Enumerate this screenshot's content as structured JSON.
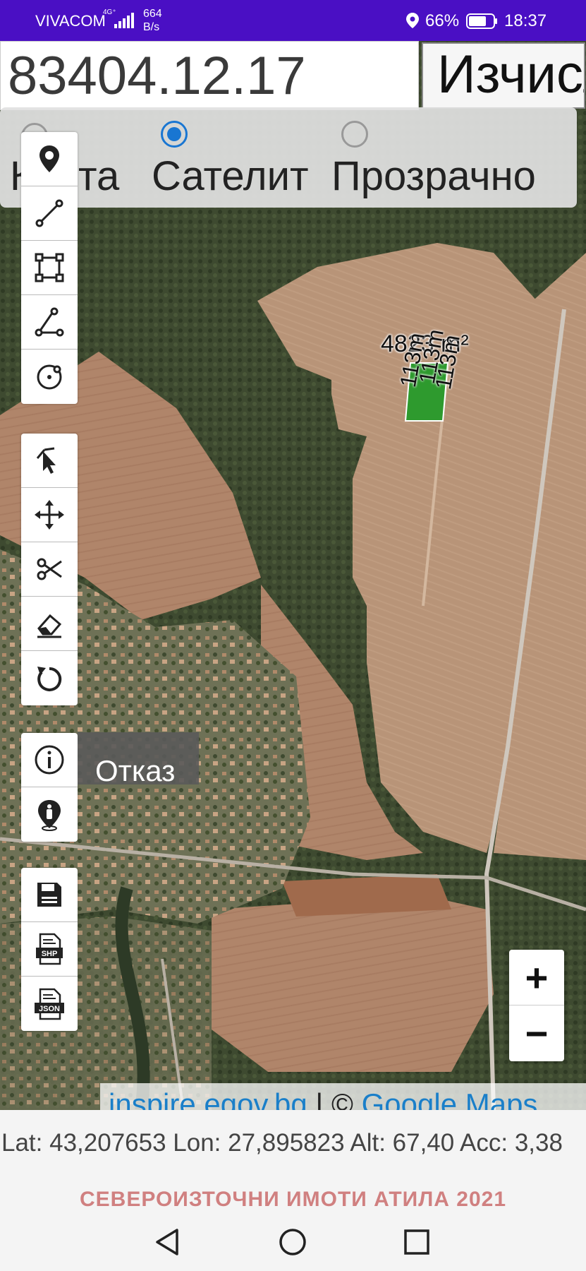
{
  "status_bar": {
    "carrier": "VIVACOM",
    "network_type": "4G⁺",
    "speed_value": "664",
    "speed_unit": "B/s",
    "battery_percent": "66%",
    "time": "18:37"
  },
  "search": {
    "value": "83404.12.17"
  },
  "calc_button": {
    "label": "Изчисли"
  },
  "map_type": {
    "options": [
      {
        "label": "Карта",
        "selected": false
      },
      {
        "label": "Сателит",
        "selected": true
      },
      {
        "label": "Прозрачно",
        "selected": false
      }
    ]
  },
  "toolbar_icons": {
    "group1": [
      "marker-icon",
      "line-icon",
      "rectangle-icon",
      "angle-icon",
      "circle-icon"
    ],
    "group2": [
      "select-icon",
      "move-icon",
      "cut-icon",
      "eraser-icon",
      "undo-icon"
    ],
    "group3": [
      "info-icon",
      "person-location-icon"
    ],
    "group4": [
      "save-icon",
      "shp-icon",
      "json-icon"
    ]
  },
  "file_icons": {
    "shp": "SHP",
    "json": "JSON"
  },
  "tooltip": {
    "text": "Отказ"
  },
  "measurement": {
    "area": "4823 m²",
    "segment_labels": [
      "113m",
      "113m",
      "113m"
    ]
  },
  "zoom": {
    "plus": "+",
    "minus": "−"
  },
  "attribution": {
    "link1": "inspire.egov.bg",
    "separator": " | © ",
    "link2": "Google Maps"
  },
  "coordinates": {
    "text": "Lat: 43,207653 Lon: 27,895823 Alt: 67,40 Acc: 3,38"
  },
  "footer": {
    "brand": "СЕВЕРОИЗТОЧНИ ИМОТИ АТИЛА 2021"
  },
  "colors": {
    "status_bar": "#4a0fc4",
    "accent": "#1976d2",
    "attribution_link": "#1a7fc9",
    "brand_text": "#d08080"
  }
}
